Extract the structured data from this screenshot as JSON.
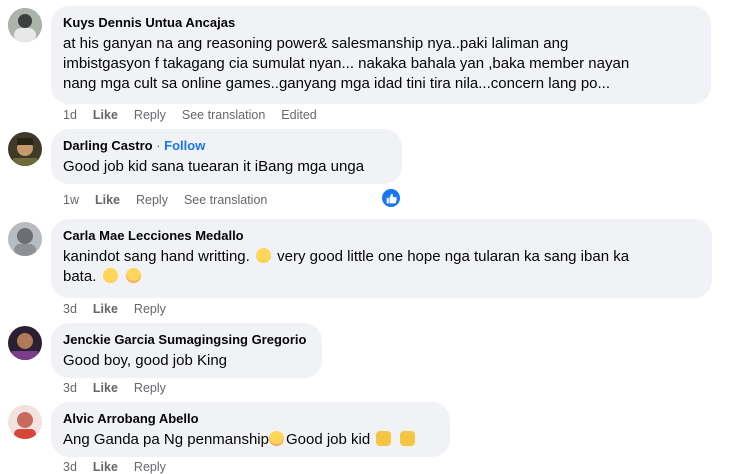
{
  "actions": {
    "like": "Like",
    "reply": "Reply",
    "see_translation": "See translation",
    "edited": "Edited"
  },
  "comments": [
    {
      "author": "Kuys Dennis Untua Ancajas",
      "text_lines": [
        "at his ganyan na ang reasoning power& salesmanship nya..paki laliman ang",
        "imbistgasyon f takagang cia sumulat nyan... nakaka bahala yan ,baka member nayan",
        "nang mga cult sa online games..ganyang mga idad tini tira nila...concern lang po..."
      ],
      "time": "1d"
    },
    {
      "author": "Darling Castro",
      "follow": "Follow",
      "text": "Good job kid sana tuearan it iBang mga unga",
      "time": "1w"
    },
    {
      "author": "Carla Mae Lecciones Medallo",
      "text_line1": "kanindot sang hand writting.",
      "text_line1b": "very good little one hope nga tularan ka sang iban ka",
      "text_line2": "bata.",
      "time": "3d"
    },
    {
      "author": "Jenckie Garcia Sumagingsing Gregorio",
      "text": "Good boy, good job King",
      "time": "3d"
    },
    {
      "author": "Alvic Arrobang Abello",
      "text_a": "Ang Ganda pa Ng penmanship",
      "text_b": "Good job kid",
      "time": "3d"
    }
  ],
  "colors": {
    "bubble": "#f0f2f5",
    "meta": "#65676b",
    "link": "#1877f2"
  }
}
